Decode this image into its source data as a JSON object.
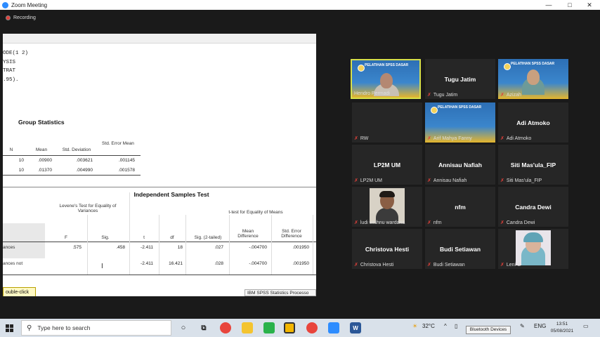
{
  "window": {
    "title": "Zoom Meeting",
    "controls": [
      "—",
      "□",
      "✕"
    ]
  },
  "recording": {
    "label": "Recording"
  },
  "spss": {
    "syntax_lines": [
      "ODE(1 2)",
      "YSIS",
      "TRAT",
      ".95)."
    ],
    "group_statistics": {
      "title": "Group Statistics",
      "headers": [
        "N",
        "Mean",
        "Std. Deviation",
        "Std. Error Mean"
      ],
      "rows": [
        [
          "10",
          ".00900",
          ".003621",
          ".001145"
        ],
        [
          "10",
          ".01370",
          ".004990",
          ".001578"
        ]
      ]
    },
    "independent_test": {
      "title": "Independent Samples Test",
      "levene_header": "Levene's Test for Equality of Variances",
      "ttest_header": "t-test for Equality of Means",
      "columns": [
        "F",
        "Sig.",
        "t",
        "df",
        "Sig. (2-tailed)",
        "Mean Difference",
        "Std. Error Difference"
      ],
      "row_labels": [
        "ances",
        "ances not"
      ],
      "rows": [
        [
          ".575",
          ".458",
          "-2.411",
          "18",
          ".027",
          "-.004700",
          ".001950"
        ],
        [
          "",
          "",
          "-2.411",
          "16.421",
          ".028",
          "-.004700",
          ".001950"
        ]
      ]
    },
    "tooltip": "ouble-click to activate",
    "status": "IBM SPSS Statistics Processo"
  },
  "participants": [
    {
      "name": "Hendro Permadi",
      "type": "video-banner"
    },
    {
      "name": "Tugu Jatim",
      "type": "name"
    },
    {
      "name": "Azizah",
      "type": "video-banner"
    },
    {
      "name": "RW",
      "type": "blank"
    },
    {
      "name": "Arif Mahya Fanny",
      "type": "video-banner"
    },
    {
      "name": "Adi Atmoko",
      "type": "name"
    },
    {
      "name": "LP2M UM",
      "type": "name"
    },
    {
      "name": "Annisau Nafiah",
      "type": "name"
    },
    {
      "name": "Siti Mas'ula_FIP",
      "type": "name"
    },
    {
      "name": "ludi wishnu wardana",
      "type": "photo"
    },
    {
      "name": "nfm",
      "type": "name"
    },
    {
      "name": "Candra Dewi",
      "type": "name"
    },
    {
      "name": "Christova Hesti",
      "type": "name"
    },
    {
      "name": "Budi Setiawan",
      "type": "name"
    },
    {
      "name": "Leni G",
      "type": "photo"
    }
  ],
  "banner_text": "PELATIHAN SPSS DASAR",
  "taskbar": {
    "search_placeholder": "Type here to search",
    "weather": "32°C",
    "language": "ENG",
    "time": "13:51",
    "date": "05/08/2021",
    "bluetooth_tooltip": "Bluetooth Devices"
  }
}
